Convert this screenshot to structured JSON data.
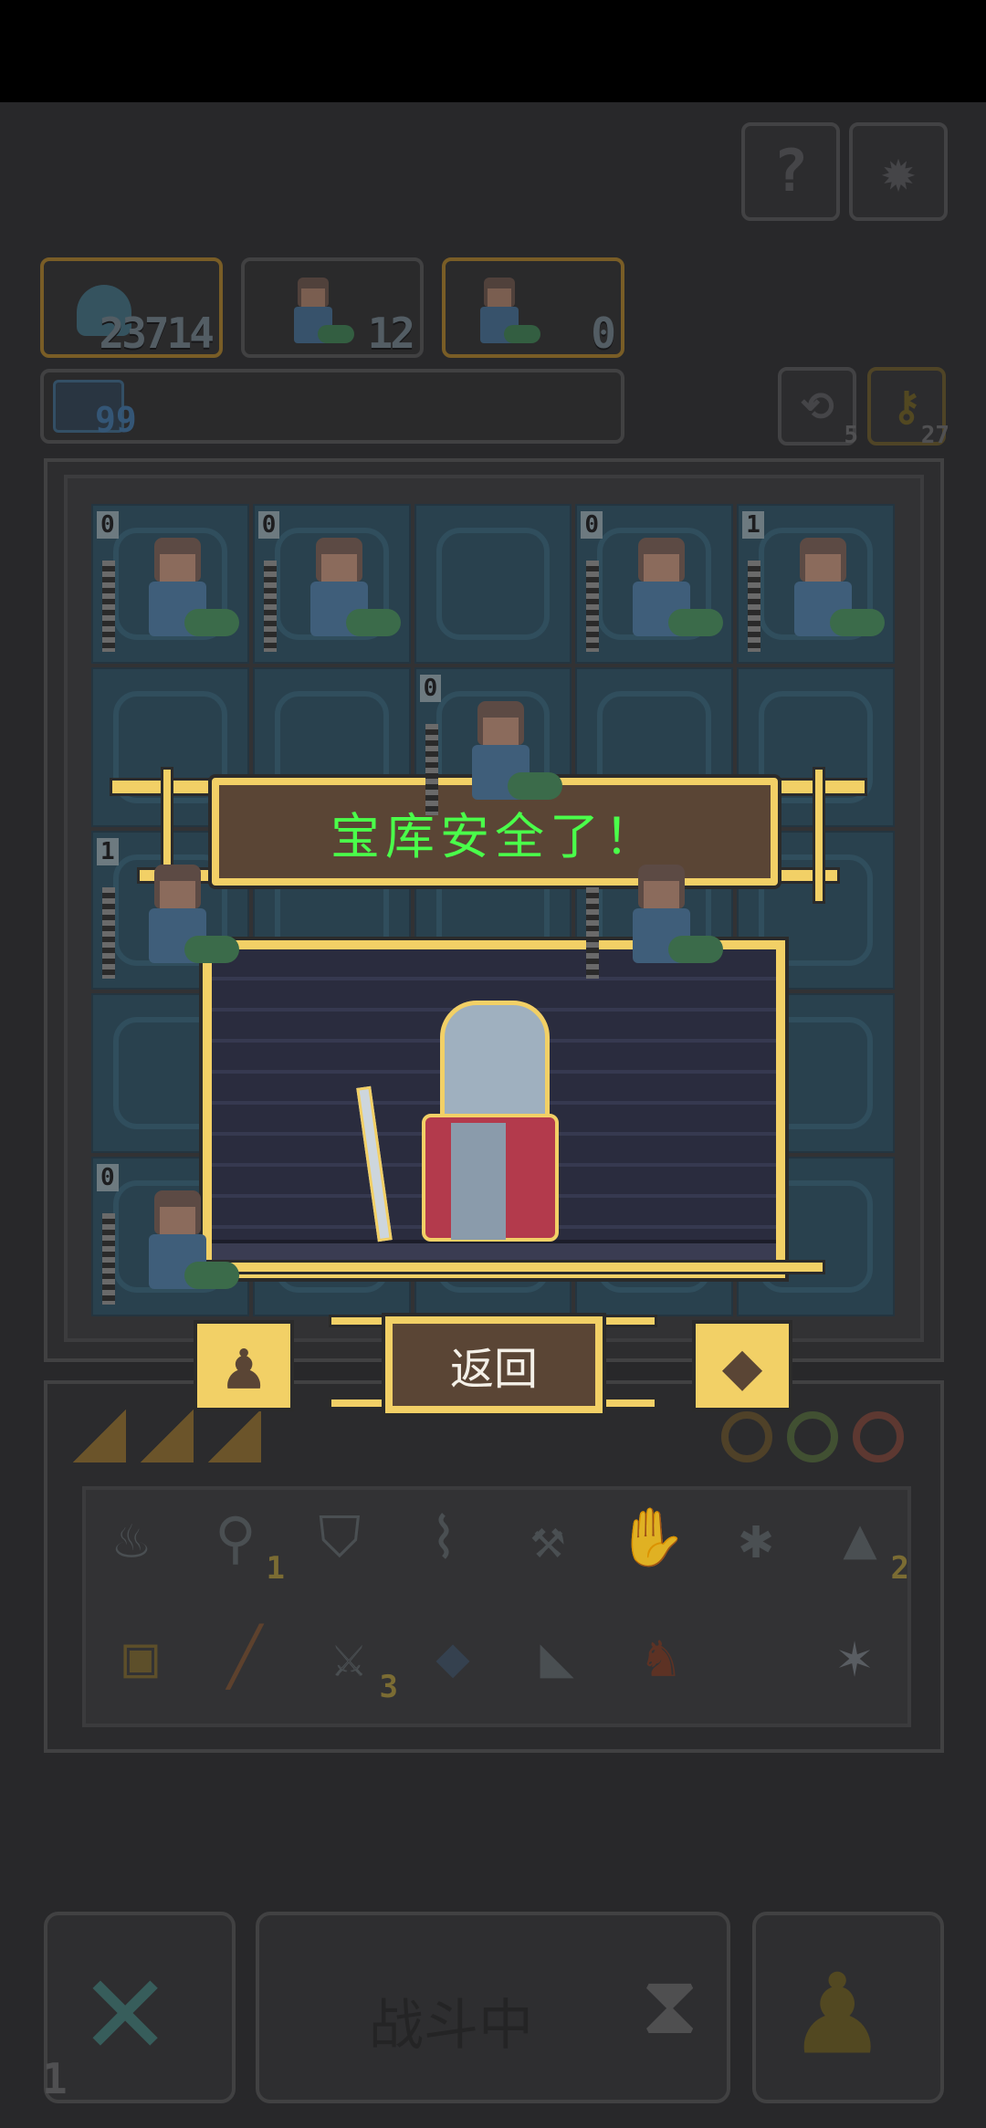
{
  "header": {
    "help_icon": "question-icon",
    "settings_icon": "gear-icon"
  },
  "team": {
    "coins": "23714",
    "unit_a_count": "12",
    "unit_b_count": "0",
    "cost": "99",
    "refresh_count": "5",
    "key_count": "27"
  },
  "board": {
    "cells": [
      {
        "level": "0",
        "unit": true
      },
      {
        "level": "0",
        "unit": true
      },
      {
        "level": "",
        "unit": false
      },
      {
        "level": "0",
        "unit": true
      },
      {
        "level": "1",
        "unit": true
      },
      {
        "level": "",
        "unit": false
      },
      {
        "level": "",
        "unit": false
      },
      {
        "level": "0",
        "unit": true
      },
      {
        "level": "",
        "unit": false
      },
      {
        "level": "",
        "unit": false
      },
      {
        "level": "1",
        "unit": true
      },
      {
        "level": "",
        "unit": false
      },
      {
        "level": "",
        "unit": false
      },
      {
        "level": "",
        "unit": true
      },
      {
        "level": "",
        "unit": false
      },
      {
        "level": "",
        "unit": false
      },
      {
        "level": "",
        "unit": false
      },
      {
        "level": "",
        "unit": false
      },
      {
        "level": "",
        "unit": false
      },
      {
        "level": "",
        "unit": false
      },
      {
        "level": "0",
        "unit": true
      },
      {
        "level": "",
        "unit": false
      },
      {
        "level": "",
        "unit": false
      },
      {
        "level": "",
        "unit": false
      },
      {
        "level": "",
        "unit": false
      }
    ]
  },
  "dialog": {
    "title": "宝库安全了！",
    "back_label": "返回",
    "left_icon": "pawn-icon",
    "right_icon": "gem-icon"
  },
  "shop": {
    "item_counts": [
      "1",
      "2",
      "3"
    ]
  },
  "footer": {
    "battle_label": "战斗中",
    "left_count": "1"
  }
}
